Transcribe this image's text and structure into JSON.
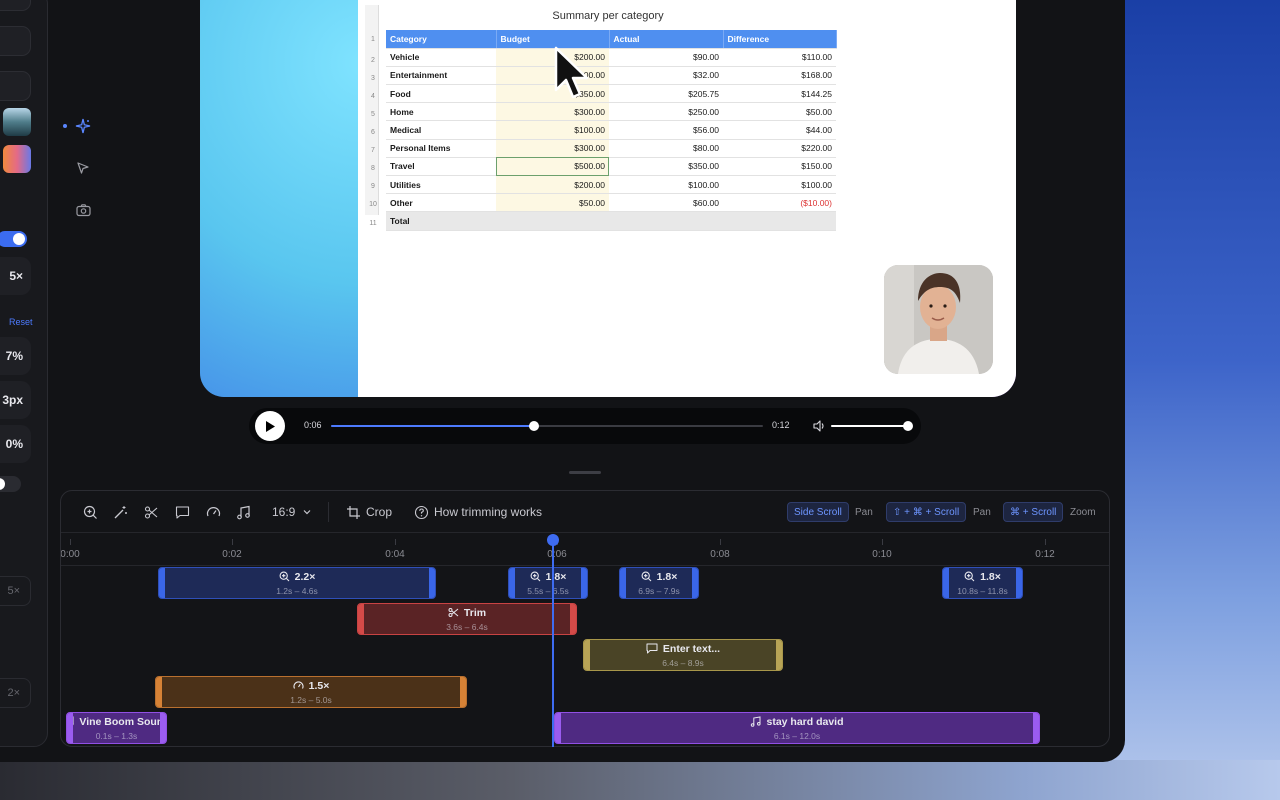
{
  "left_panel": {
    "value_1": "5×",
    "reset_label": "Reset",
    "value_2": "7%",
    "value_3": "3px",
    "value_4": "0%",
    "value_5": "5×",
    "value_6": "2×"
  },
  "spreadsheet": {
    "title": "Summary per category",
    "headers": [
      "Category",
      "Budget",
      "Actual",
      "Difference"
    ],
    "rows": [
      {
        "num": "2",
        "category": "Vehicle",
        "budget": "$200.00",
        "actual": "$90.00",
        "difference": "$110.00"
      },
      {
        "num": "3",
        "category": "Entertainment",
        "budget": "$200.00",
        "actual": "$32.00",
        "difference": "$168.00"
      },
      {
        "num": "4",
        "category": "Food",
        "budget": "$350.00",
        "actual": "$205.75",
        "difference": "$144.25"
      },
      {
        "num": "5",
        "category": "Home",
        "budget": "$300.00",
        "actual": "$250.00",
        "difference": "$50.00"
      },
      {
        "num": "6",
        "category": "Medical",
        "budget": "$100.00",
        "actual": "$56.00",
        "difference": "$44.00"
      },
      {
        "num": "7",
        "category": "Personal Items",
        "budget": "$300.00",
        "actual": "$80.00",
        "difference": "$220.00"
      },
      {
        "num": "8",
        "category": "Travel",
        "budget": "$500.00",
        "actual": "$350.00",
        "difference": "$150.00"
      },
      {
        "num": "9",
        "category": "Utilities",
        "budget": "$200.00",
        "actual": "$100.00",
        "difference": "$100.00"
      },
      {
        "num": "10",
        "category": "Other",
        "budget": "$50.00",
        "actual": "$60.00",
        "difference": "($10.00)"
      }
    ],
    "total_num": "11",
    "total_label": "Total",
    "header_num": "1"
  },
  "player": {
    "current_time": "0:06",
    "total_time": "0:12",
    "progress": 0.47,
    "volume": 1.0
  },
  "toolbar": {
    "aspect_ratio": "16:9",
    "crop_label": "Crop",
    "help_label": "How trimming works",
    "shortcut_1": "Side Scroll",
    "shortcut_1_action": "Pan",
    "shortcut_2": "⇧ + ⌘ + Scroll",
    "shortcut_2_action": "Pan",
    "shortcut_3": "⌘ + Scroll",
    "shortcut_3_action": "Zoom"
  },
  "ruler": {
    "ticks": [
      "0:00",
      "0:02",
      "0:04",
      "0:06",
      "0:08",
      "0:10",
      "0:12"
    ]
  },
  "clips": {
    "zoom_1": {
      "label": "2.2×",
      "range": "1.2s – 4.6s"
    },
    "zoom_2": {
      "label": "1.8×",
      "range": "5.5s – 6.5s"
    },
    "zoom_3": {
      "label": "1.8×",
      "range": "6.9s – 7.9s"
    },
    "zoom_4": {
      "label": "1.8×",
      "range": "10.8s – 11.8s"
    },
    "trim": {
      "label": "Trim",
      "range": "3.6s – 6.4s"
    },
    "text": {
      "label": "Enter text...",
      "range": "6.4s – 8.9s"
    },
    "speed": {
      "label": "1.5×",
      "range": "1.2s – 5.0s"
    },
    "audio_1": {
      "label": "Vine Boom Sound",
      "range": "0.1s – 1.3s"
    },
    "audio_2": {
      "label": "stay hard david",
      "range": "6.1s – 12.0s"
    }
  },
  "colors": {
    "accent": "#3e6cf2",
    "zoom": "#3a66e8",
    "trim": "#d44a48",
    "text": "#b8a456",
    "speed": "#d68236",
    "audio": "#9b5cf0"
  }
}
